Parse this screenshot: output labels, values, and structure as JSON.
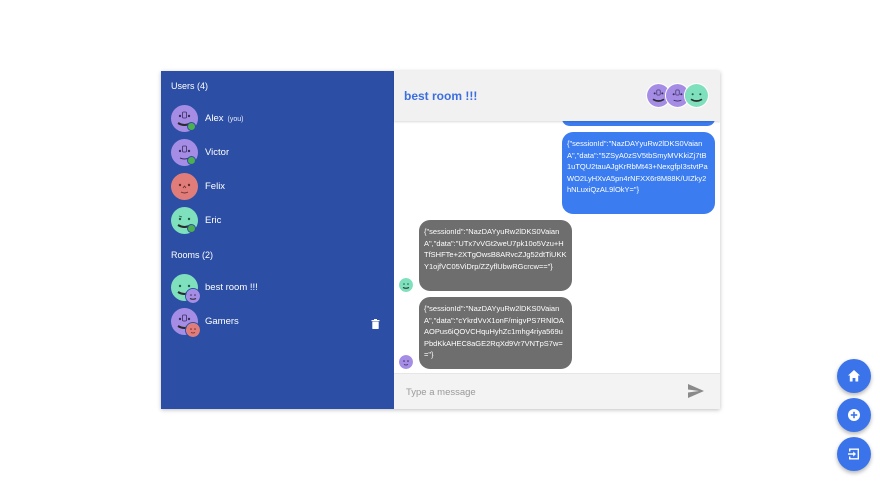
{
  "sidebar": {
    "users_title": "Users (4)",
    "users": [
      {
        "name": "Alex",
        "tag": "(you)",
        "avatar_color": "#a58de6",
        "online": true
      },
      {
        "name": "Victor",
        "tag": "",
        "avatar_color": "#a58de6",
        "online": true
      },
      {
        "name": "Felix",
        "tag": "",
        "avatar_color": "#e07d7a",
        "online": false
      },
      {
        "name": "Eric",
        "tag": "",
        "avatar_color": "#7ee0bd",
        "online": true
      }
    ],
    "rooms_title": "Rooms (2)",
    "rooms": [
      {
        "name": "best room !!!",
        "avatar_color": "#7ee0bd"
      },
      {
        "name": "Gamers",
        "avatar_color": "#a58de6"
      }
    ]
  },
  "chat": {
    "title": "best room !!!",
    "messages": [
      {
        "direction": "out",
        "text": "{\"sessionId\":\"NazDAYyuRw2lDKS0VaianA\",\"data\":\"5ZSyA0zSV5tbSmyMVKkiZj7tB1uTQU2tauAJgKrRbMt43+NexgfpI3stvtPaWO2LyHXvA5pn4rNFXX6r8M88K/UIZky2hNLuxiQzAL9lOkY=\"}"
      },
      {
        "direction": "in",
        "sender": "Eric",
        "text": "{\"sessionId\":\"NazDAYyuRw2lDKS0VaianA\",\"data\":\"UTx7vVGt2weU7pk10o5Vzu+HTfSHFTe+2XTgOwsB8ARvcZJg52dtTiUKKY1ojfVC05ViDrp/ZZyflUbwRGcrcw==\"}"
      },
      {
        "direction": "in",
        "sender": "Victor",
        "text": "{\"sessionId\":\"NazDAYyuRw2lDKS0VaianA\",\"data\":\"cYkrdVvX1onF/migvPS7RNlOAAOPus6iQOVCHquHyhZc1mhg4riya569uPbdKkAHEC8aGE2RqXd9Vr7VNTpS7w==\"}"
      }
    ],
    "composer_placeholder": "Type a message"
  },
  "fabs": [
    {
      "name": "home",
      "icon": "home-icon"
    },
    {
      "name": "add",
      "icon": "add-circle-icon"
    },
    {
      "name": "logout",
      "icon": "exit-icon"
    }
  ],
  "colors": {
    "sidebar_bg": "#2c4fa5",
    "accent": "#3b6fe0",
    "outgoing_bubble": "#3b7df0",
    "incoming_bubble": "#6e6e6e",
    "online": "#4caf50",
    "fab": "#3b74ea"
  }
}
